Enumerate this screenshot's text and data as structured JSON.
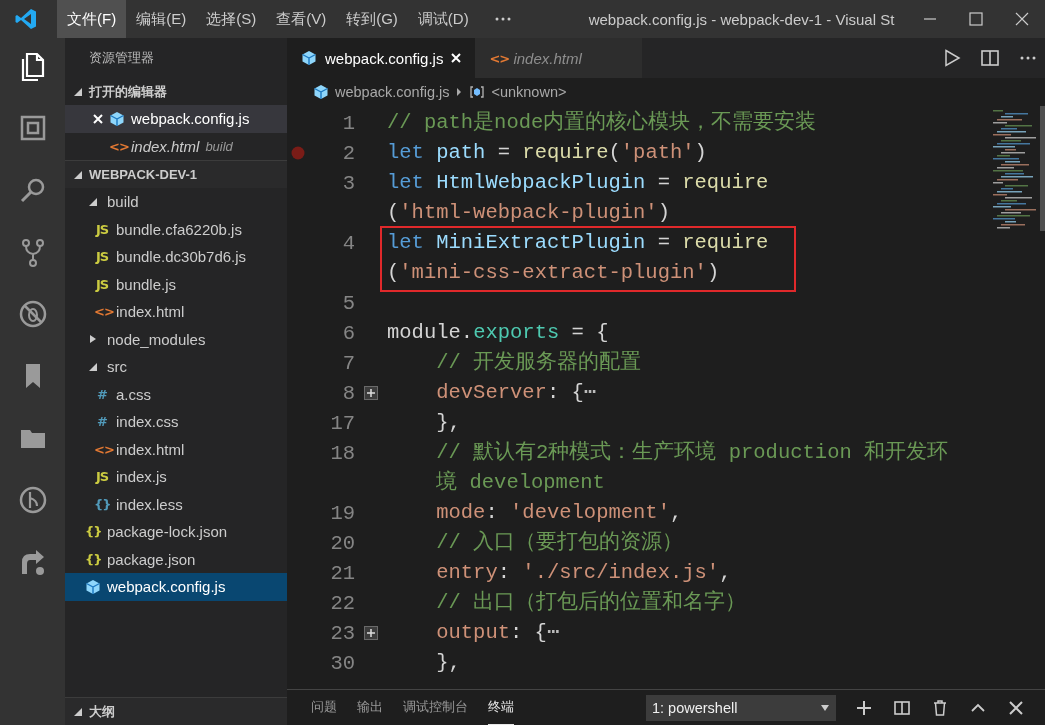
{
  "title_bar": {
    "menus": [
      {
        "label": "文件(F)",
        "selected": true
      },
      {
        "label": "编辑(E)",
        "selected": false
      },
      {
        "label": "选择(S)",
        "selected": false
      },
      {
        "label": "查看(V)",
        "selected": false
      },
      {
        "label": "转到(G)",
        "selected": false
      },
      {
        "label": "调试(D)",
        "selected": false
      }
    ],
    "title": "webpack.config.js - webpack-dev-1 - Visual St"
  },
  "activity_bar": {
    "items": [
      {
        "kind": "explorer",
        "selected": true
      },
      {
        "kind": "extensions",
        "selected": false
      },
      {
        "kind": "search",
        "selected": false
      },
      {
        "kind": "source-control",
        "selected": false
      },
      {
        "kind": "debug",
        "selected": false
      },
      {
        "kind": "bookmark",
        "selected": false
      },
      {
        "kind": "folder",
        "selected": false
      },
      {
        "kind": "git-graph",
        "selected": false
      },
      {
        "kind": "share",
        "selected": false
      }
    ]
  },
  "sidebar": {
    "title": "资源管理器",
    "sections": [
      {
        "title": "打开的编辑器",
        "expanded": true,
        "open_editors": [
          {
            "label": "webpack.config.js",
            "kind": "webpack",
            "selected": true,
            "preview": false
          },
          {
            "label": "index.html",
            "kind": "html",
            "icon": "<>",
            "description": "build",
            "selected": false,
            "preview": true
          }
        ]
      },
      {
        "title": "WEBPACK-DEV-1",
        "expanded": true,
        "tree": [
          {
            "label": "build",
            "kind": "folder",
            "expanded": true,
            "selected": false,
            "children": [
              {
                "label": "bundle.cfa6220b.js",
                "kind": "js",
                "icon": "JS",
                "selected": false
              },
              {
                "label": "bundle.dc30b7d6.js",
                "kind": "js",
                "icon": "JS",
                "selected": false
              },
              {
                "label": "bundle.js",
                "kind": "js",
                "icon": "JS",
                "selected": false
              },
              {
                "label": "index.html",
                "kind": "html",
                "icon": "<>",
                "selected": false
              }
            ]
          },
          {
            "label": "node_modules",
            "kind": "folder",
            "expanded": false,
            "selected": false
          },
          {
            "label": "src",
            "kind": "folder",
            "expanded": true,
            "selected": false,
            "children": [
              {
                "label": "a.css",
                "kind": "css",
                "icon": "#",
                "selected": false
              },
              {
                "label": "index.css",
                "kind": "css",
                "icon": "#",
                "selected": false
              },
              {
                "label": "index.html",
                "kind": "html",
                "icon": "<>",
                "selected": false
              },
              {
                "label": "index.js",
                "kind": "js",
                "icon": "JS",
                "selected": false
              },
              {
                "label": "index.less",
                "kind": "less",
                "icon": "{}",
                "selected": false
              }
            ]
          },
          {
            "label": "package-lock.json",
            "kind": "json",
            "icon": "{}",
            "selected": false
          },
          {
            "label": "package.json",
            "kind": "json",
            "icon": "{}",
            "selected": false
          },
          {
            "label": "webpack.config.js",
            "kind": "webpack",
            "selected": true
          }
        ]
      },
      {
        "title": "大纲",
        "expanded": true
      }
    ]
  },
  "editor": {
    "tabs": [
      {
        "label": "webpack.config.js",
        "kind": "webpack",
        "selected": true,
        "preview": false
      },
      {
        "label": "index.html",
        "kind": "html",
        "icon": "<>",
        "selected": false,
        "preview": true
      }
    ],
    "breadcrumb": [
      {
        "label": "webpack.config.js",
        "kind": "webpack"
      },
      {
        "label": "<unknown>",
        "kind": "symbol"
      }
    ],
    "lines": [
      {
        "number": "1",
        "breakpoint": false,
        "folded": false,
        "highlighted": false,
        "wraps": [
          {
            "indented": false,
            "tokens": [
              {
                "kind": "comment",
                "text": "// path是node内置的核心模块，不需要安装"
              }
            ]
          }
        ]
      },
      {
        "number": "2",
        "breakpoint": true,
        "folded": false,
        "highlighted": false,
        "wraps": [
          {
            "indented": false,
            "tokens": [
              {
                "kind": "keyword",
                "text": "let "
              },
              {
                "kind": "variable",
                "text": "path"
              },
              {
                "kind": "plain",
                "text": " = "
              },
              {
                "kind": "function",
                "text": "require"
              },
              {
                "kind": "plain",
                "text": "("
              },
              {
                "kind": "string",
                "text": "'path'"
              },
              {
                "kind": "plain",
                "text": ")"
              }
            ]
          }
        ]
      },
      {
        "number": "3",
        "breakpoint": false,
        "folded": false,
        "highlighted": false,
        "wraps": [
          {
            "indented": false,
            "tokens": [
              {
                "kind": "keyword",
                "text": "let "
              },
              {
                "kind": "variable",
                "text": "HtmlWebpackPlugin"
              },
              {
                "kind": "plain",
                "text": " = "
              },
              {
                "kind": "function",
                "text": "require"
              }
            ]
          },
          {
            "indented": false,
            "tokens": [
              {
                "kind": "plain",
                "text": "("
              },
              {
                "kind": "string",
                "text": "'html-webpack-plugin'"
              },
              {
                "kind": "plain",
                "text": ")"
              }
            ]
          }
        ]
      },
      {
        "number": "4",
        "breakpoint": false,
        "folded": false,
        "highlighted": true,
        "wraps": [
          {
            "indented": false,
            "tokens": [
              {
                "kind": "keyword",
                "text": "let "
              },
              {
                "kind": "variable",
                "text": "MiniExtractPlugin"
              },
              {
                "kind": "plain",
                "text": " = "
              },
              {
                "kind": "function",
                "text": "require"
              }
            ]
          },
          {
            "indented": false,
            "tokens": [
              {
                "kind": "plain",
                "text": "("
              },
              {
                "kind": "string",
                "text": "'mini-css-extract-plugin'"
              },
              {
                "kind": "plain",
                "text": ")"
              }
            ]
          }
        ]
      },
      {
        "number": "5",
        "breakpoint": false,
        "folded": false,
        "highlighted": false
      },
      {
        "number": "6",
        "breakpoint": false,
        "folded": false,
        "highlighted": false,
        "wraps": [
          {
            "indented": false,
            "tokens": [
              {
                "kind": "plain",
                "text": "module."
              },
              {
                "kind": "type",
                "text": "exports"
              },
              {
                "kind": "plain",
                "text": " = {"
              }
            ]
          }
        ]
      },
      {
        "number": "7",
        "breakpoint": false,
        "folded": false,
        "highlighted": false,
        "wraps": [
          {
            "indented": true,
            "tokens": [
              {
                "kind": "comment",
                "text": "// 开发服务器的配置"
              }
            ]
          }
        ]
      },
      {
        "number": "8",
        "breakpoint": false,
        "folded": true,
        "highlighted": false,
        "wraps": [
          {
            "indented": true,
            "tokens": [
              {
                "kind": "property",
                "text": "devServer"
              },
              {
                "kind": "plain",
                "text": ": {"
              },
              {
                "kind": "dim",
                "text": "⋯"
              }
            ]
          }
        ]
      },
      {
        "number": "17",
        "breakpoint": false,
        "folded": false,
        "highlighted": false,
        "wraps": [
          {
            "indented": true,
            "tokens": [
              {
                "kind": "plain",
                "text": "},"
              }
            ]
          }
        ]
      },
      {
        "number": "18",
        "breakpoint": false,
        "folded": false,
        "highlighted": false,
        "wraps": [
          {
            "indented": true,
            "tokens": [
              {
                "kind": "comment",
                "text": "// 默认有2种模式：生产环境 production 和开发环"
              }
            ]
          },
          {
            "indented": true,
            "tokens": [
              {
                "kind": "comment",
                "text": "境 development"
              }
            ]
          }
        ]
      },
      {
        "number": "19",
        "breakpoint": false,
        "folded": false,
        "highlighted": false,
        "wraps": [
          {
            "indented": true,
            "tokens": [
              {
                "kind": "property",
                "text": "mode"
              },
              {
                "kind": "plain",
                "text": ": "
              },
              {
                "kind": "string",
                "text": "'development'"
              },
              {
                "kind": "plain",
                "text": ","
              }
            ]
          }
        ]
      },
      {
        "number": "20",
        "breakpoint": false,
        "folded": false,
        "highlighted": false,
        "wraps": [
          {
            "indented": true,
            "tokens": [
              {
                "kind": "comment",
                "text": "// 入口（要打包的资源）"
              }
            ]
          }
        ]
      },
      {
        "number": "21",
        "breakpoint": false,
        "folded": false,
        "highlighted": false,
        "wraps": [
          {
            "indented": true,
            "tokens": [
              {
                "kind": "property",
                "text": "entry"
              },
              {
                "kind": "plain",
                "text": ": "
              },
              {
                "kind": "string",
                "text": "'./src/index.js'"
              },
              {
                "kind": "plain",
                "text": ","
              }
            ]
          }
        ]
      },
      {
        "number": "22",
        "breakpoint": false,
        "folded": false,
        "highlighted": false,
        "wraps": [
          {
            "indented": true,
            "tokens": [
              {
                "kind": "comment",
                "text": "// 出口（打包后的位置和名字）"
              }
            ]
          }
        ]
      },
      {
        "number": "23",
        "breakpoint": false,
        "folded": true,
        "highlighted": false,
        "wraps": [
          {
            "indented": true,
            "tokens": [
              {
                "kind": "property",
                "text": "output"
              },
              {
                "kind": "plain",
                "text": ": {"
              },
              {
                "kind": "dim",
                "text": "⋯"
              }
            ]
          }
        ]
      },
      {
        "number": "30",
        "breakpoint": false,
        "folded": false,
        "highlighted": false,
        "wraps": [
          {
            "indented": true,
            "tokens": [
              {
                "kind": "plain",
                "text": "},"
              }
            ]
          }
        ]
      }
    ]
  },
  "panel": {
    "tabs": [
      {
        "label": "问题",
        "selected": false
      },
      {
        "label": "输出",
        "selected": false
      },
      {
        "label": "调试控制台",
        "selected": false
      },
      {
        "label": "终端",
        "selected": true
      }
    ],
    "terminal_select": "1: powershell"
  }
}
